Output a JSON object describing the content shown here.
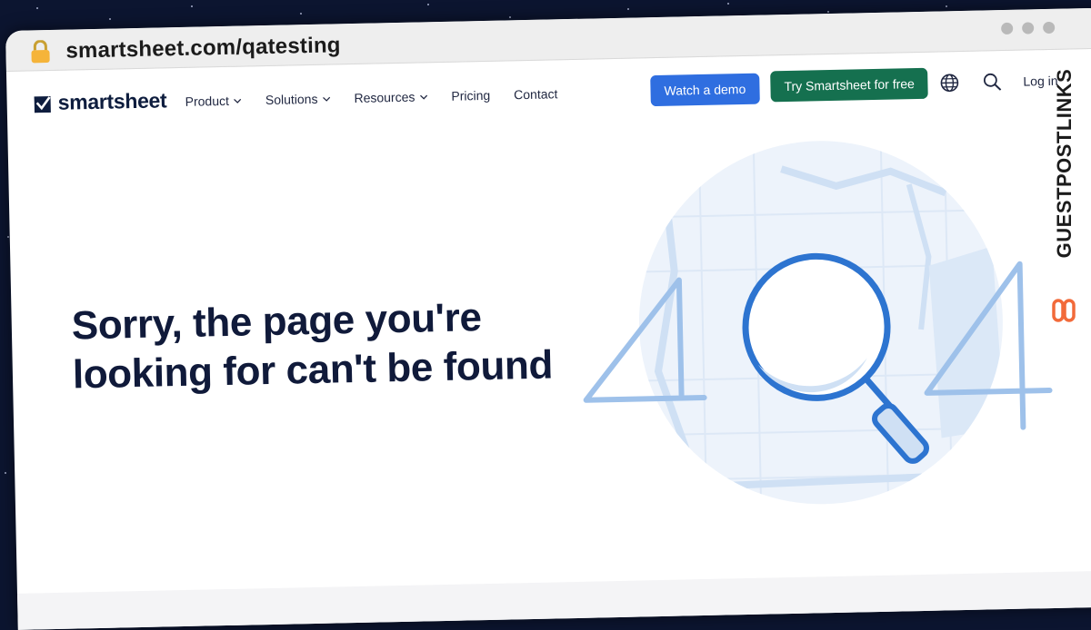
{
  "browser": {
    "url": "smartsheet.com/qatesting"
  },
  "nav": {
    "logo_text": "smartsheet",
    "menu": [
      {
        "label": "Product",
        "has_dropdown": true
      },
      {
        "label": "Solutions",
        "has_dropdown": true
      },
      {
        "label": "Resources",
        "has_dropdown": true
      },
      {
        "label": "Pricing",
        "has_dropdown": false
      },
      {
        "label": "Contact",
        "has_dropdown": false
      }
    ],
    "demo_button": "Watch a demo",
    "try_button": "Try Smartsheet for free",
    "login": "Log in"
  },
  "main": {
    "headline_line1": "Sorry, the page you're",
    "headline_line2": "looking for can't be found"
  },
  "watermark": {
    "text": "GUESTPOSTLINKS"
  },
  "colors": {
    "demo_button": "#2f6ee0",
    "try_button": "#15704f",
    "headline": "#101a3a",
    "illustration_primary": "#2d74d0",
    "illustration_light": "#9ec1ea",
    "watermark_accent": "#f26a3a"
  },
  "icons": [
    "lock-icon",
    "smartsheet-logo-icon",
    "chevron-down-icon",
    "globe-icon",
    "search-icon",
    "magnifier-illustration",
    "link-icon"
  ]
}
